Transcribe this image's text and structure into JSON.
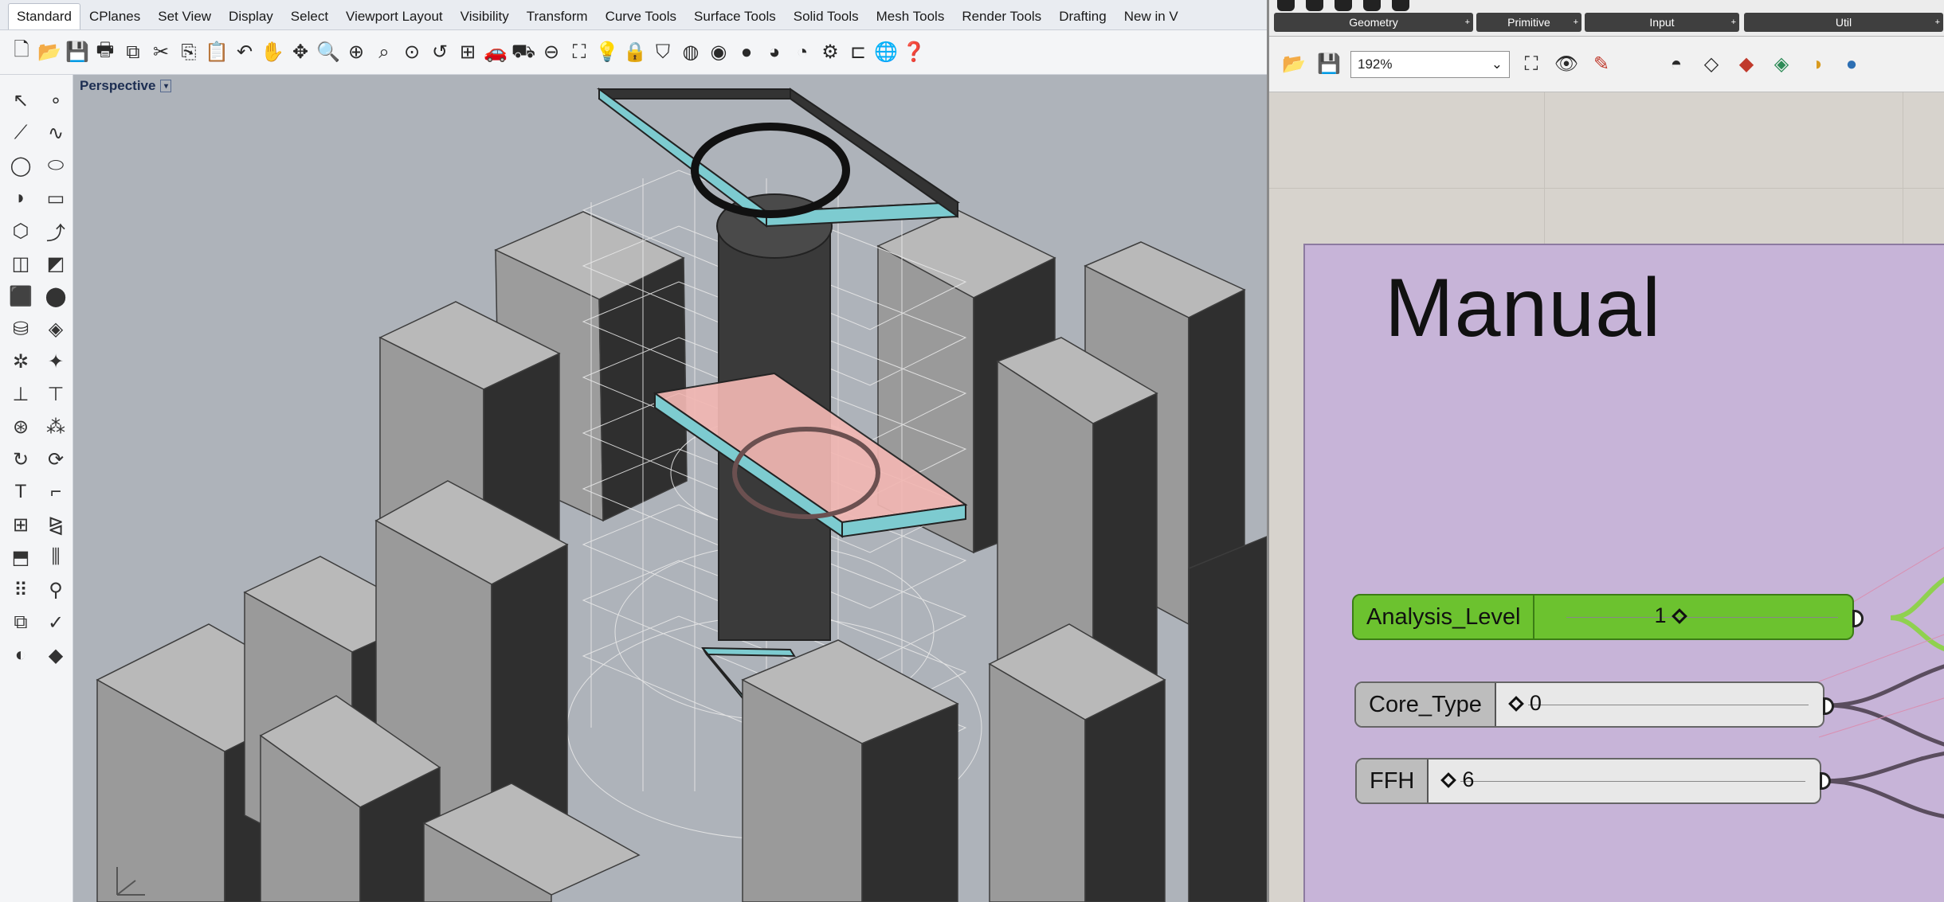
{
  "rhino": {
    "tabs": [
      "Standard",
      "CPlanes",
      "Set View",
      "Display",
      "Select",
      "Viewport Layout",
      "Visibility",
      "Transform",
      "Curve Tools",
      "Surface Tools",
      "Solid Tools",
      "Mesh Tools",
      "Render Tools",
      "Drafting",
      "New in V"
    ],
    "active_tab": "Standard",
    "viewport_title": "Perspective",
    "viewport_caret": "▾",
    "axis_label": "z y\n   x"
  },
  "grasshopper": {
    "ribbon_groups": [
      "Geometry",
      "Primitive",
      "Input",
      "Util"
    ],
    "zoom": "192%",
    "zoom_caret": "⌄",
    "group_title": "Manual",
    "sliders": [
      {
        "name": "Analysis_Level",
        "value": "1"
      },
      {
        "name": "Core_Type",
        "value": "0"
      },
      {
        "name": "FFH",
        "value": "6"
      }
    ]
  },
  "colors": {
    "slider_green": "#6cc22f",
    "group_fill": "#c7b4d8",
    "slab_pink": "#f2b7b3",
    "slab_edge": "#7dcbd0"
  }
}
